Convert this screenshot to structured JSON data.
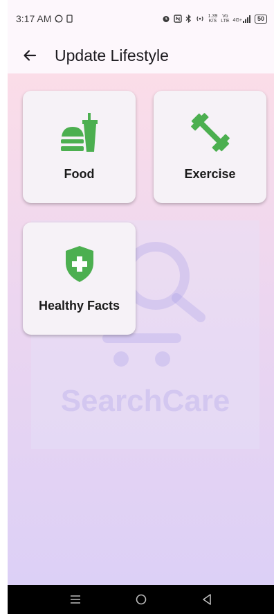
{
  "status_bar": {
    "time": "3:17 AM",
    "speed_value": "1.39",
    "speed_unit": "K/S",
    "network_top": "Vo",
    "network_bottom": "LTE",
    "signal_label": "4G+",
    "battery": "50"
  },
  "app_bar": {
    "title": "Update Lifestyle",
    "back_icon": "arrow-left-icon"
  },
  "cards": [
    {
      "label": "Food",
      "icon": "fastfood-icon"
    },
    {
      "label": "Exercise",
      "icon": "dumbbell-icon"
    },
    {
      "label": "Healthy Facts",
      "icon": "shield-plus-icon"
    }
  ],
  "watermark": {
    "text": "SearchCare"
  },
  "colors": {
    "accent_green": "#4caf50",
    "app_bar_bg": "#fdf7fc",
    "gradient_top": "#fbdde8",
    "gradient_bottom": "#dcd0f6"
  }
}
